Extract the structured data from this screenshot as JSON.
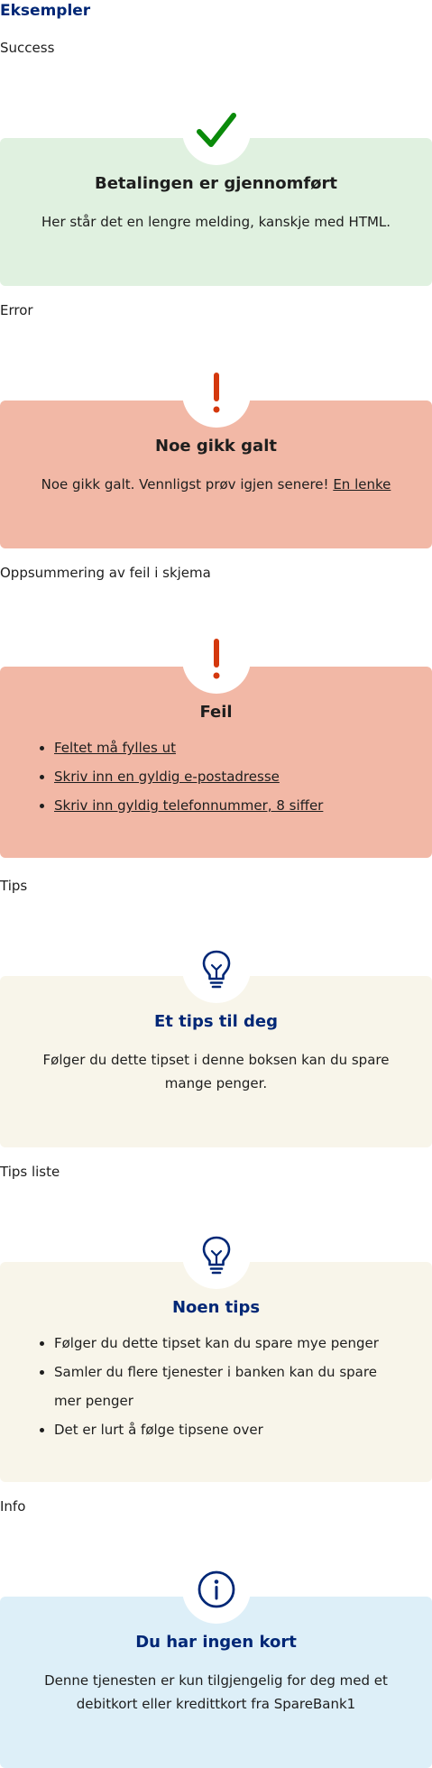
{
  "page_title": "Eksempler",
  "colors": {
    "success_bg": "#e0f1e0",
    "error_bg": "#f2b8a6",
    "tips_bg": "#f8f5ea",
    "info_bg": "#ddeff8",
    "brand_blue": "#002776",
    "check_green": "#0a8a0a",
    "error_red": "#d4380d"
  },
  "sections": {
    "success": {
      "label": "Success",
      "icon": "check-icon",
      "title": "Betalingen er gjennomført",
      "text": "Her står det en lengre melding, kanskje med HTML."
    },
    "error": {
      "label": "Error",
      "icon": "exclamation-icon",
      "title": "Noe gikk galt",
      "text": "Noe gikk galt. Vennligst prøv igjen senere! ",
      "link": "En lenke"
    },
    "form_errors": {
      "label": "Oppsummering av feil i skjema",
      "icon": "exclamation-icon",
      "title": "Feil",
      "items": [
        "Feltet må fylles ut",
        "Skriv inn en gyldig e-postadresse",
        "Skriv inn gyldig telefonnummer, 8 siffer"
      ]
    },
    "tips": {
      "label": "Tips",
      "icon": "lightbulb-icon",
      "title": "Et tips til deg",
      "text": "Følger du dette tipset i denne boksen kan du spare mange penger."
    },
    "tips_list": {
      "label": "Tips liste",
      "icon": "lightbulb-icon",
      "title": "Noen tips",
      "items": [
        "Følger du dette tipset kan du spare mye penger",
        "Samler du flere tjenester i banken kan du spare mer penger",
        "Det er lurt å følge tipsene over"
      ]
    },
    "info": {
      "label": "Info",
      "icon": "info-icon",
      "title": "Du har ingen kort",
      "text": "Denne tjenesten er kun tilgjengelig for deg med et debitkort eller kredittkort fra SpareBank1"
    }
  }
}
